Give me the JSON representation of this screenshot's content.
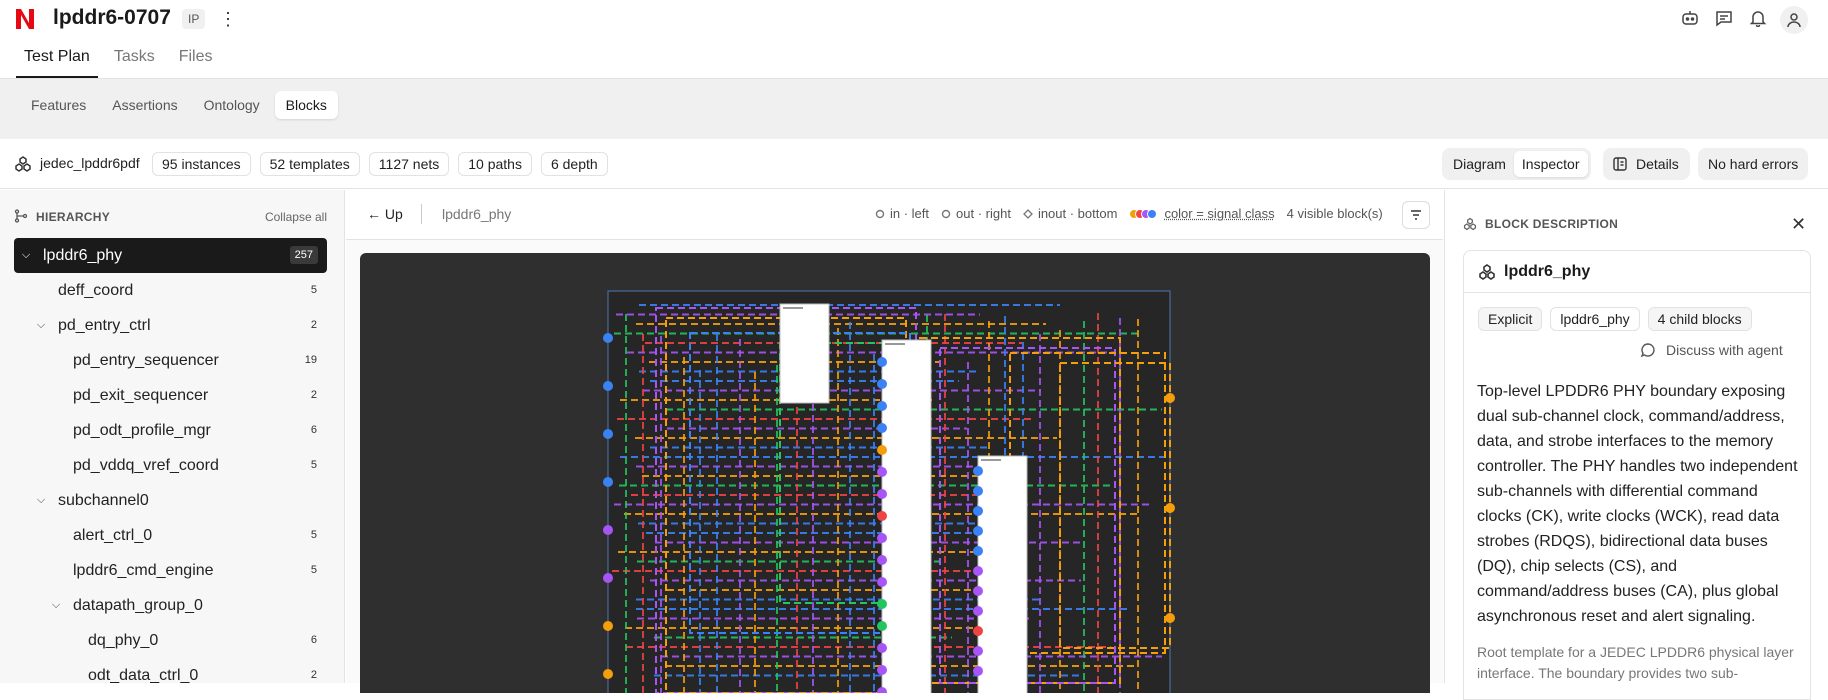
{
  "app": {
    "title": "lpddr6-0707",
    "badge": "IP",
    "brand_color": "#e50914"
  },
  "main_tabs": [
    "Test Plan",
    "Tasks",
    "Files"
  ],
  "sub_tabs": [
    "Features",
    "Assertions",
    "Ontology",
    "Blocks"
  ],
  "stats": {
    "dataset": "jedec_lpddr6pdf",
    "chips": [
      "95 instances",
      "52 templates",
      "1127 nets",
      "10 paths",
      "6 depth"
    ]
  },
  "view_toggle": {
    "diagram": "Diagram",
    "inspector": "Inspector"
  },
  "details_label": "Details",
  "errors_label": "No hard errors",
  "hierarchy": {
    "label": "HIERARCHY",
    "collapse_label": "Collapse all",
    "nodes": [
      {
        "name": "lpddr6_phy",
        "count": "257"
      },
      {
        "name": "deff_coord",
        "count": "5"
      },
      {
        "name": "pd_entry_ctrl",
        "count": "2"
      },
      {
        "name": "pd_entry_sequencer",
        "count": "19"
      },
      {
        "name": "pd_exit_sequencer",
        "count": "2"
      },
      {
        "name": "pd_odt_profile_mgr",
        "count": "6"
      },
      {
        "name": "pd_vddq_vref_coord",
        "count": "5"
      },
      {
        "name": "subchannel0",
        "count": ""
      },
      {
        "name": "alert_ctrl_0",
        "count": "5"
      },
      {
        "name": "lpddr6_cmd_engine",
        "count": "5"
      },
      {
        "name": "datapath_group_0",
        "count": ""
      },
      {
        "name": "dq_phy_0",
        "count": "6"
      },
      {
        "name": "odt_data_ctrl_0",
        "count": "2"
      }
    ]
  },
  "canvas": {
    "up_label": "← Up",
    "breadcrumb": "lpddr6_phy",
    "legend": {
      "in": "in · left",
      "out": "out · right",
      "inout": "inout · bottom",
      "color": "color = signal class"
    },
    "visible_blocks": "4 visible block(s)",
    "signal_colors": [
      "#3b82f6",
      "#a855f7",
      "#f59e0b",
      "#22c55e",
      "#ef4444",
      "#ec4899"
    ]
  },
  "inspector": {
    "label": "BLOCK DESCRIPTION",
    "title": "lpddr6_phy",
    "tags": [
      "Explicit",
      "lpddr6_phy",
      "4 child blocks"
    ],
    "discuss_label": "Discuss with agent",
    "description": "Top-level LPDDR6 PHY boundary exposing dual sub-channel clock, command/address, data, and strobe interfaces to the memory controller. The PHY handles two independent sub-channels with differential command clocks (CK), write clocks (WCK), read data strobes (RDQS), bidirectional data buses (DQ), chip selects (CS), and command/address buses (CA), plus global asynchronous reset and alert signaling.",
    "sub_description": "Root template for a JEDEC LPDDR6 physical layer interface. The boundary provides two sub-"
  }
}
